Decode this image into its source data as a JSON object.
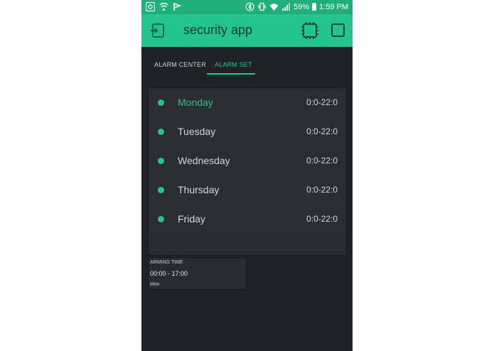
{
  "status_bar": {
    "left_icons": [
      "notification-icon",
      "shield-icon",
      "flag-icon"
    ],
    "right_icons": [
      "bluetooth-icon",
      "vibrate-icon",
      "wifi-icon",
      "signal-icon"
    ],
    "battery": "59%",
    "time": "1:59 PM"
  },
  "app_bar": {
    "title": "security app",
    "accent": "#23c48e"
  },
  "tabs": [
    {
      "label": "ALARM CENTER",
      "active": false
    },
    {
      "label": "ALARM SET",
      "active": true
    }
  ],
  "schedule": {
    "rows": [
      {
        "day": "Monday",
        "time": "0:0-22:0",
        "highlighted": true
      },
      {
        "day": "Tuesday",
        "time": "0:0-22:0",
        "highlighted": false
      },
      {
        "day": "Wednesday",
        "time": "0:0-22:0",
        "highlighted": false
      },
      {
        "day": "Thursday",
        "time": "0:0-22:0",
        "highlighted": false
      },
      {
        "day": "Friday",
        "time": "0:0-22:0",
        "highlighted": false
      }
    ]
  },
  "arming_time": {
    "label": "ARMING TIME",
    "range": "00:00 - 17:00",
    "days": "Mon"
  }
}
